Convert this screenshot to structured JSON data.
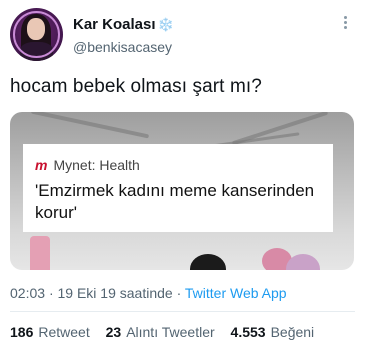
{
  "user": {
    "display_name": "Kar Koalası",
    "name_emoji": "❄️",
    "handle": "@benkisacasey"
  },
  "tweet": {
    "text": "hocam bebek olması şart mı?"
  },
  "media_card": {
    "source_logo": "m",
    "source": "Mynet: Health",
    "headline": "'Emzirmek kadını meme kanserinden korur'"
  },
  "meta": {
    "time": "02:03",
    "separator1": "·",
    "date": "19 Eki 19 saatinde",
    "separator2": "·",
    "client": "Twitter Web App"
  },
  "stats": {
    "retweets_count": "186",
    "retweets_label": "Retweet",
    "quotes_count": "23",
    "quotes_label": "Alıntı Tweetler",
    "likes_count": "4.553",
    "likes_label": "Beğeni"
  },
  "colors": {
    "link": "#1d9bf0",
    "secondary_text": "#536471",
    "mynet_red": "#c8102e"
  },
  "icons": {
    "more": "more-vertical-icon",
    "snowflake": "snowflake-icon"
  }
}
